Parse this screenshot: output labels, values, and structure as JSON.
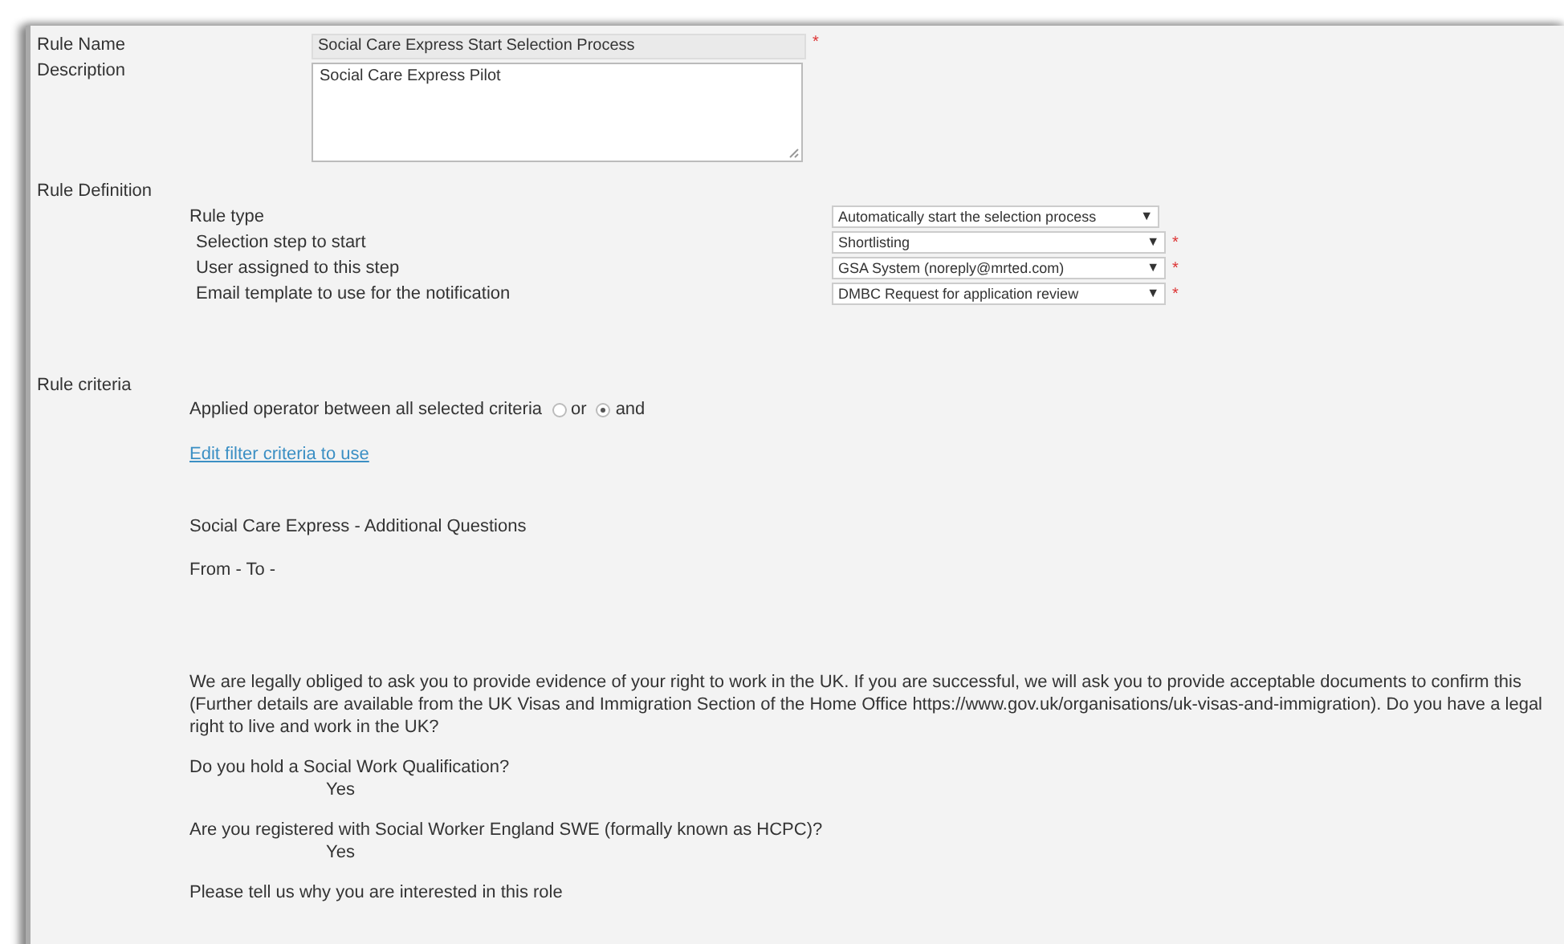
{
  "rule_name": {
    "label": "Rule Name",
    "value": "Social Care Express Start Selection Process",
    "required_mark": "*"
  },
  "description": {
    "label": "Description",
    "value": "Social Care Express Pilot"
  },
  "rule_definition": {
    "label": "Rule Definition",
    "rows": [
      {
        "label": "Rule type",
        "value": "Automatically start the selection process",
        "arrow": "▼",
        "wide": false
      },
      {
        "label": "Selection step to start",
        "value": "Shortlisting",
        "arrow": "▼",
        "required_mark": "*",
        "wide": true
      },
      {
        "label": "User assigned to this step",
        "value": "GSA System (noreply@mrted.com)",
        "arrow": "▼",
        "required_mark": "*",
        "wide": true
      },
      {
        "label": "Email template to use for the notification",
        "value": "DMBC Request for application review",
        "arrow": "▼",
        "required_mark": "*",
        "wide": true
      }
    ]
  },
  "rule_criteria": {
    "label": "Rule criteria",
    "operator_label": "Applied operator between all selected criteria",
    "operators": [
      {
        "label": "or",
        "selected": false
      },
      {
        "label": "and",
        "selected": true
      }
    ],
    "link": "Edit filter criteria to use",
    "section_title": "Social Care Express - Additional Questions",
    "range": "From - To -",
    "questions": [
      {
        "text": "We are legally obliged to ask you to provide evidence of your right to work in the UK. If you are successful, we will ask you to provide acceptable documents to confirm this (Further details are available from the UK Visas and Immigration Section of the Home Office https://www.gov.uk/organisations/uk-visas-and-immigration). Do you have a legal right to live and work in the UK?"
      },
      {
        "text": "Do you hold a Social Work Qualification?",
        "answer": "Yes"
      },
      {
        "text": "Are you registered with Social Worker England SWE (formally known as HCPC)?",
        "answer": "Yes"
      },
      {
        "text": "Please tell us why you are interested in this role"
      }
    ]
  }
}
